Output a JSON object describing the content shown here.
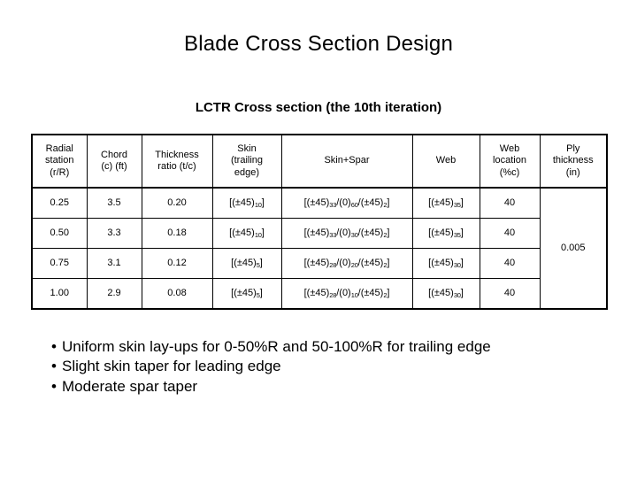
{
  "slide": {
    "title": "Blade Cross Section Design",
    "table_caption": "LCTR Cross section (the 10th iteration)"
  },
  "table": {
    "headers": [
      "Radial station (r/R)",
      "Chord (c) (ft)",
      "Thickness ratio (t/c)",
      "Skin (trailing edge)",
      "Skin+Spar",
      "Web",
      "Web location (%c)",
      "Ply thickness (in)"
    ],
    "header_lines": {
      "radial": [
        "Radial",
        "station",
        "(r/R)"
      ],
      "chord": [
        "Chord",
        "(c) (ft)"
      ],
      "thickness": [
        "Thickness",
        "ratio (t/c)"
      ],
      "skin_te": [
        "Skin",
        "(trailing",
        "edge)"
      ],
      "skin_spar": [
        "Skin+Spar"
      ],
      "web": [
        "Web"
      ],
      "web_loc": [
        "Web",
        "location",
        "(%c)"
      ],
      "ply": [
        "Ply",
        "thickness",
        "(in)"
      ]
    },
    "rows": [
      {
        "radial_station": "0.25",
        "chord": "3.5",
        "thickness_ratio": "0.20",
        "skin_te": {
          "pre": "[(±45)",
          "sub": "10",
          "post": "]"
        },
        "skin_spar": {
          "p1": "[(±45)",
          "s1": "33",
          "p2": "/(0)",
          "s2": "60",
          "p3": "/(±45)",
          "s3": "2",
          "p4": "]"
        },
        "web": {
          "pre": "[(±45)",
          "sub": "35",
          "post": "]"
        },
        "web_location": "40"
      },
      {
        "radial_station": "0.50",
        "chord": "3.3",
        "thickness_ratio": "0.18",
        "skin_te": {
          "pre": "[(±45)",
          "sub": "10",
          "post": "]"
        },
        "skin_spar": {
          "p1": "[(±45)",
          "s1": "33",
          "p2": "/(0)",
          "s2": "30",
          "p3": "/(±45)",
          "s3": "2",
          "p4": "]"
        },
        "web": {
          "pre": "[(±45)",
          "sub": "35",
          "post": "]"
        },
        "web_location": "40"
      },
      {
        "radial_station": "0.75",
        "chord": "3.1",
        "thickness_ratio": "0.12",
        "skin_te": {
          "pre": "[(±45)",
          "sub": "5",
          "post": "]"
        },
        "skin_spar": {
          "p1": "[(±45)",
          "s1": "28",
          "p2": "/(0)",
          "s2": "20",
          "p3": "/(±45)",
          "s3": "2",
          "p4": "]"
        },
        "web": {
          "pre": "[(±45)",
          "sub": "30",
          "post": "]"
        },
        "web_location": "40"
      },
      {
        "radial_station": "1.00",
        "chord": "2.9",
        "thickness_ratio": "0.08",
        "skin_te": {
          "pre": "[(±45)",
          "sub": "5",
          "post": "]"
        },
        "skin_spar": {
          "p1": "[(±45)",
          "s1": "28",
          "p2": "/(0)",
          "s2": "10",
          "p3": "/(±45)",
          "s3": "2",
          "p4": "]"
        },
        "web": {
          "pre": "[(±45)",
          "sub": "30",
          "post": "]"
        },
        "web_location": "40"
      }
    ],
    "ply_thickness_merged": "0.005"
  },
  "bullets": [
    "Uniform skin lay-ups for 0-50%R and 50-100%R for trailing edge",
    "Slight skin taper for leading edge",
    "Moderate spar taper"
  ],
  "bullet_marker": "•"
}
